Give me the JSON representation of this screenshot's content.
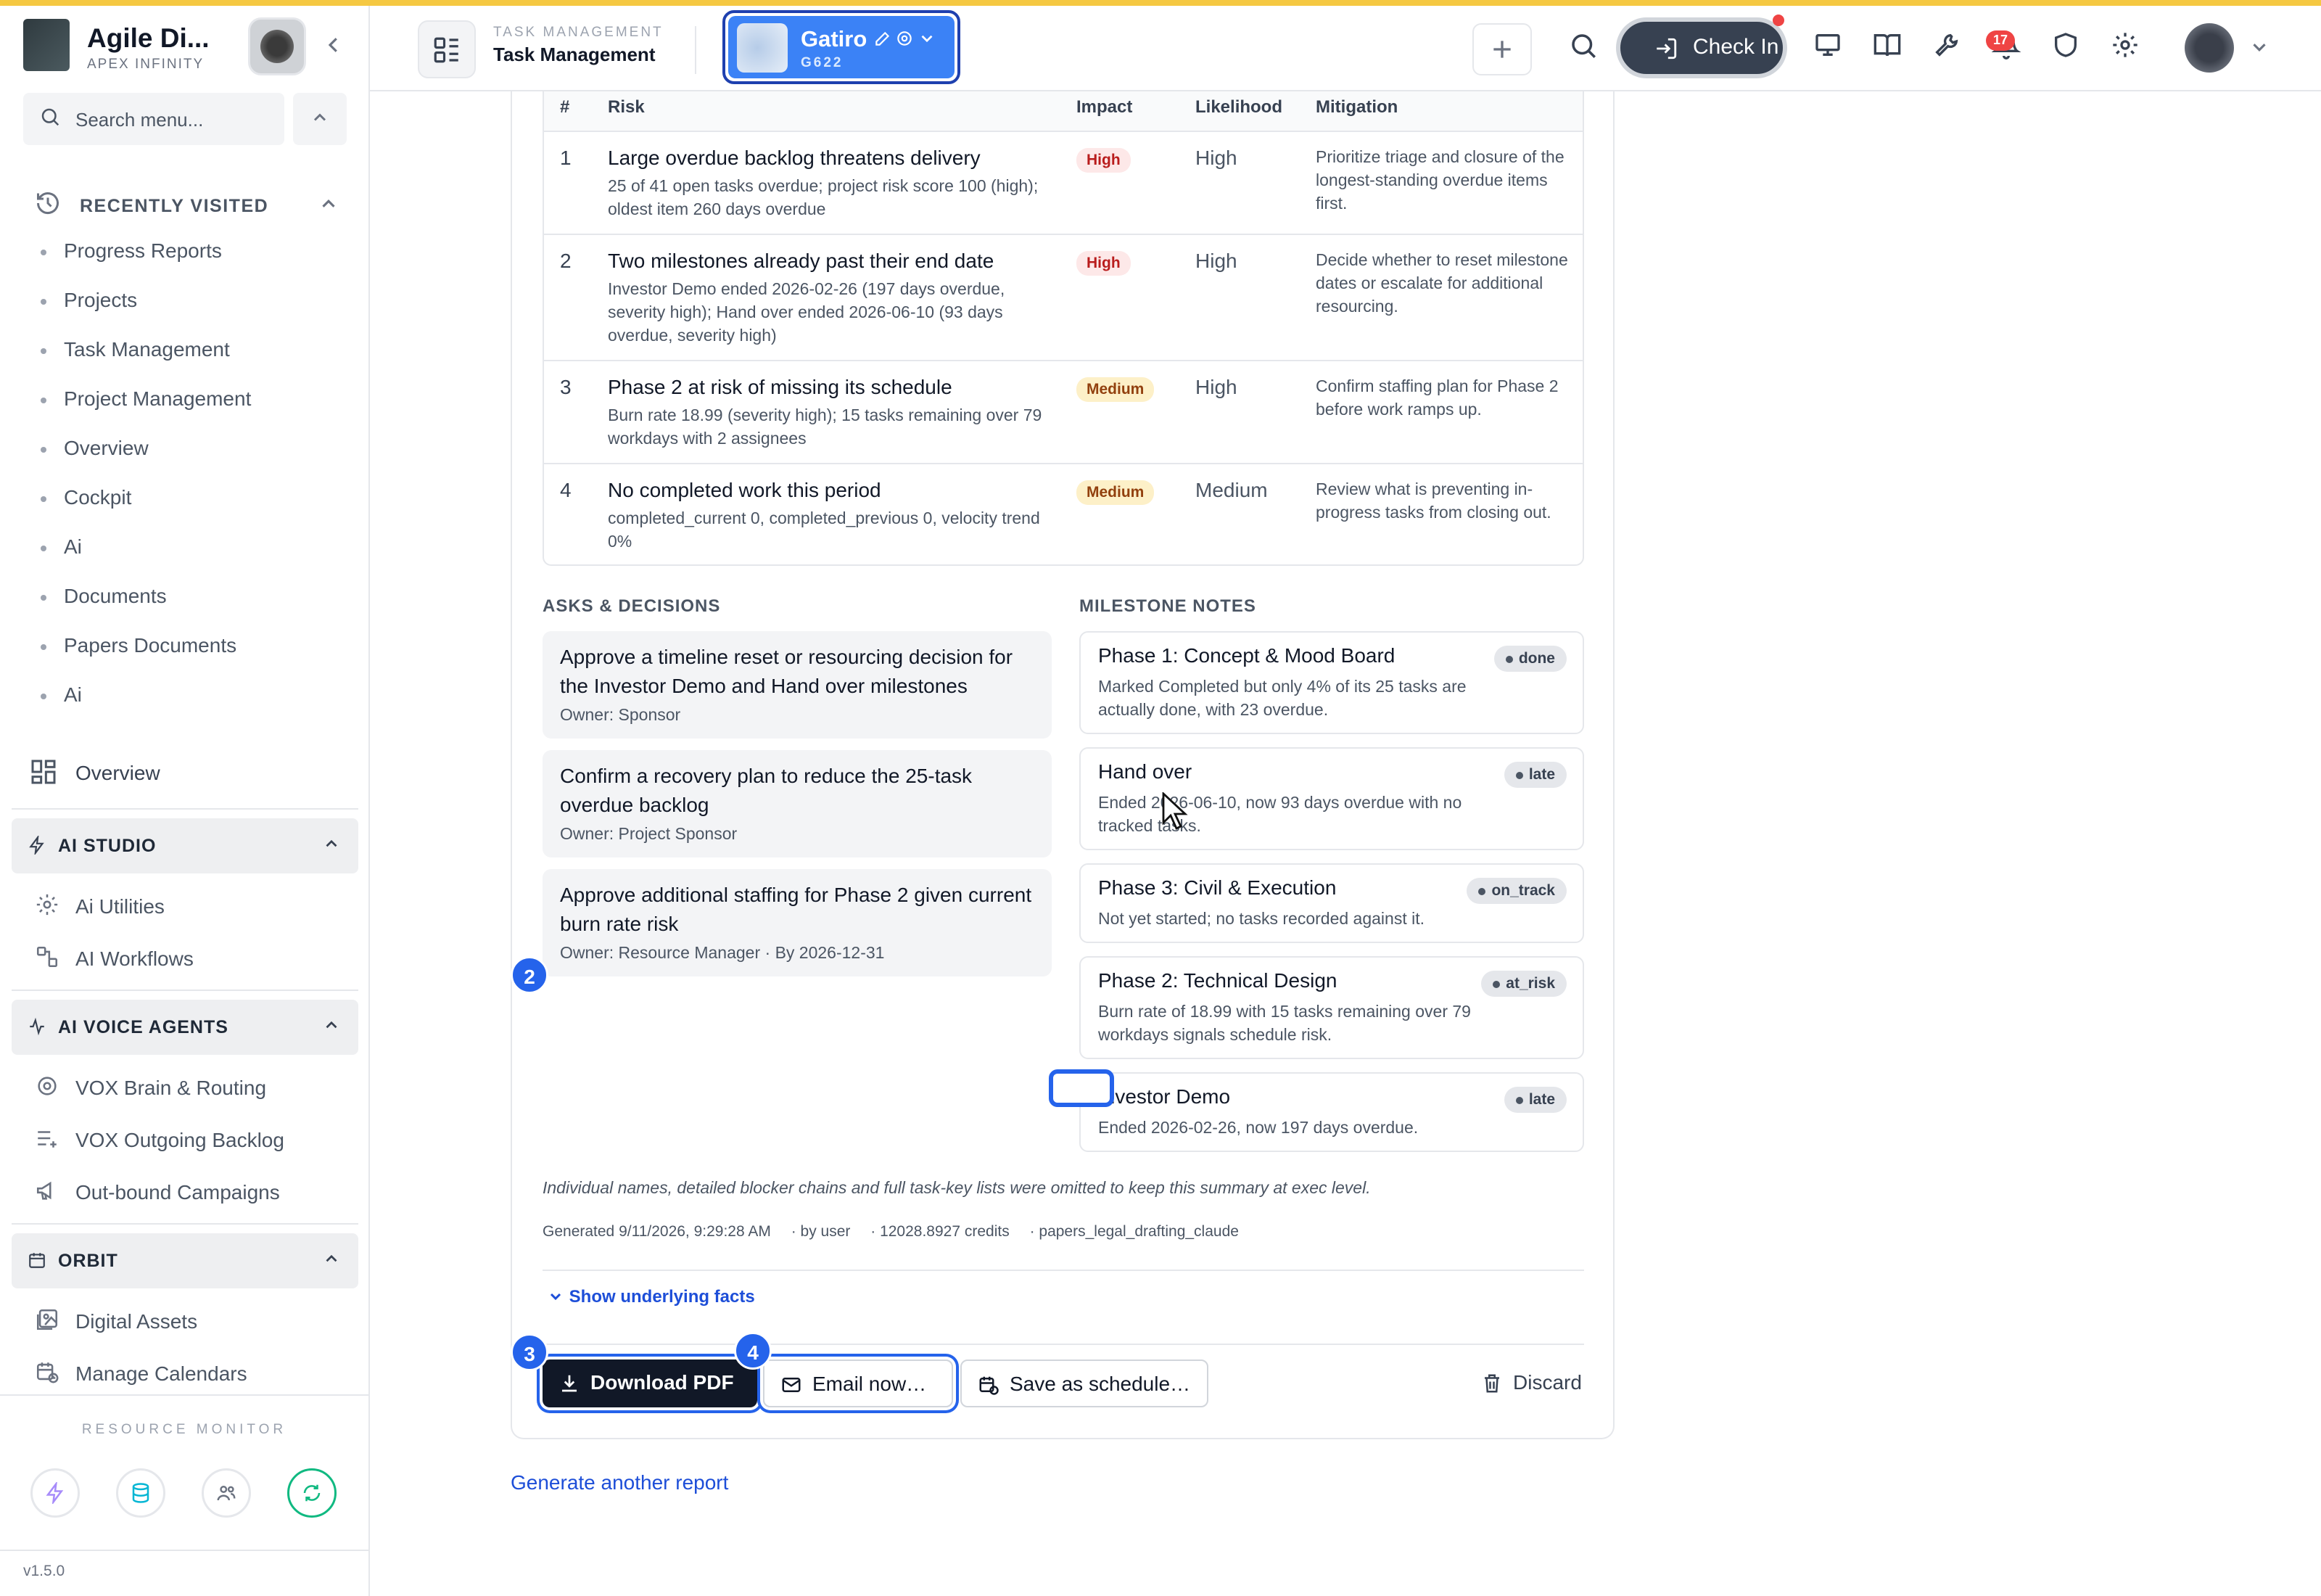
{
  "brand": {
    "name": "Agile Di...",
    "org": "APEX INFINITY"
  },
  "sidebar": {
    "search_placeholder": "Search menu...",
    "recently_visited": {
      "title": "RECENTLY VISITED",
      "items": [
        "Progress Reports",
        "Projects",
        "Task Management",
        "Project Management",
        "Overview",
        "Cockpit",
        "Ai",
        "Documents",
        "Papers Documents",
        "Ai"
      ]
    },
    "overview_label": "Overview",
    "ai_studio": {
      "title": "AI STUDIO",
      "items": [
        "Ai Utilities",
        "AI Workflows"
      ]
    },
    "ai_voice_agents": {
      "title": "AI VOICE AGENTS",
      "items": [
        "VOX Brain & Routing",
        "VOX Outgoing Backlog",
        "Out-bound Campaigns"
      ]
    },
    "orbit": {
      "title": "ORBIT",
      "items": [
        "Digital Assets",
        "Manage Calendars"
      ]
    },
    "resource_monitor": "RESOURCE MONITOR",
    "version": "v1.5.0"
  },
  "header": {
    "section_small": "TASK MANAGEMENT",
    "section_title": "Task Management",
    "workspace_name": "Gatiro",
    "workspace_code": "G622",
    "checkin_label": "Check In",
    "notification_count": "17"
  },
  "risks": {
    "columns": [
      "#",
      "Risk",
      "Impact",
      "Likelihood",
      "Mitigation"
    ],
    "rows": [
      {
        "num": "1",
        "title": "Large overdue backlog threatens delivery",
        "detail": "25 of 41 open tasks overdue; project risk score 100 (high); oldest item 260 days overdue",
        "impact": "High",
        "likelihood": "High",
        "mitigation": "Prioritize triage and closure of the longest-standing overdue items first."
      },
      {
        "num": "2",
        "title": "Two milestones already past their end date",
        "detail": "Investor Demo ended 2026-02-26 (197 days overdue, severity high); Hand over ended 2026-06-10 (93 days overdue, severity high)",
        "impact": "High",
        "likelihood": "High",
        "mitigation": "Decide whether to reset milestone dates or escalate for additional resourcing."
      },
      {
        "num": "3",
        "title": "Phase 2 at risk of missing its schedule",
        "detail": "Burn rate 18.99 (severity high); 15 tasks remaining over 79 workdays with 2 assignees",
        "impact": "Medium",
        "likelihood": "High",
        "mitigation": "Confirm staffing plan for Phase 2 before work ramps up."
      },
      {
        "num": "4",
        "title": "No completed work this period",
        "detail": "completed_current 0, completed_previous 0, velocity trend 0%",
        "impact": "Medium",
        "likelihood": "Medium",
        "mitigation": "Review what is preventing in-progress tasks from closing out."
      }
    ]
  },
  "asks": {
    "title": "ASKS & DECISIONS",
    "items": [
      {
        "text": "Approve a timeline reset or resourcing decision for the Investor Demo and Hand over milestones",
        "owner": "Owner: Sponsor"
      },
      {
        "text": "Confirm a recovery plan to reduce the 25-task overdue backlog",
        "owner": "Owner: Project Sponsor"
      },
      {
        "text": "Approve additional staffing for Phase 2 given current burn rate risk",
        "owner": "Owner: Resource Manager · By 2026-12-31"
      }
    ]
  },
  "milestones": {
    "title": "MILESTONE NOTES",
    "items": [
      {
        "name": "Phase 1: Concept & Mood Board",
        "status": "done",
        "note": "Marked Completed but only 4% of its 25 tasks are actually done, with 23 overdue."
      },
      {
        "name": "Hand over",
        "status": "late",
        "note": "Ended 2026-06-10, now 93 days overdue with no tracked tasks."
      },
      {
        "name": "Phase 3: Civil & Execution",
        "status": "on_track",
        "note": "Not yet started; no tasks recorded against it."
      },
      {
        "name": "Phase 2: Technical Design",
        "status": "at_risk",
        "note": "Burn rate of 18.99 with 15 tasks remaining over 79 workdays signals schedule risk."
      },
      {
        "name": "Investor Demo",
        "status": "late",
        "note": "Ended 2026-02-26, now 197 days overdue."
      }
    ]
  },
  "footer": {
    "note": "Individual names, detailed blocker chains and full task-key lists were omitted to keep this summary at exec level.",
    "generated": "Generated 9/11/2026, 9:29:28 AM",
    "by": "· by user",
    "credits": "· 12028.8927 credits",
    "model": "· papers_legal_drafting_claude",
    "show_facts": "Show underlying facts"
  },
  "actions": {
    "download": "Download PDF",
    "email": "Email now…",
    "schedule": "Save as schedule…",
    "discard": "Discard",
    "generate_another": "Generate another report"
  },
  "markers": [
    "2",
    "3",
    "4"
  ]
}
